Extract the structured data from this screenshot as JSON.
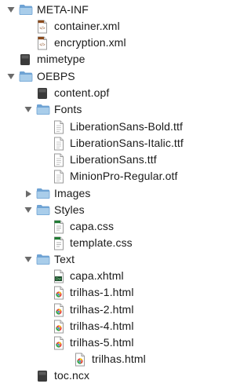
{
  "items": [
    {
      "label": "META-INF",
      "level": 0,
      "kind": "folder",
      "expanded": true
    },
    {
      "label": "container.xml",
      "level": 1,
      "kind": "xml"
    },
    {
      "label": "encryption.xml",
      "level": 1,
      "kind": "xml"
    },
    {
      "label": "mimetype",
      "level": 0,
      "kind": "binary"
    },
    {
      "label": "OEBPS",
      "level": 0,
      "kind": "folder",
      "expanded": true
    },
    {
      "label": "content.opf",
      "level": 1,
      "kind": "binary"
    },
    {
      "label": "Fonts",
      "level": 1,
      "kind": "folder",
      "expanded": true
    },
    {
      "label": "LiberationSans-Bold.ttf",
      "level": 2,
      "kind": "font"
    },
    {
      "label": "LiberationSans-Italic.ttf",
      "level": 2,
      "kind": "font"
    },
    {
      "label": "LiberationSans.ttf",
      "level": 2,
      "kind": "font"
    },
    {
      "label": "MinionPro-Regular.otf",
      "level": 2,
      "kind": "font"
    },
    {
      "label": "Images",
      "level": 1,
      "kind": "folder",
      "expanded": false
    },
    {
      "label": "Styles",
      "level": 1,
      "kind": "folder",
      "expanded": true
    },
    {
      "label": "capa.css",
      "level": 2,
      "kind": "css"
    },
    {
      "label": "template.css",
      "level": 2,
      "kind": "css"
    },
    {
      "label": "Text",
      "level": 1,
      "kind": "folder",
      "expanded": true
    },
    {
      "label": "capa.xhtml",
      "level": 2,
      "kind": "xhtml",
      "badge": "DW"
    },
    {
      "label": "trilhas-1.html",
      "level": 2,
      "kind": "html"
    },
    {
      "label": "trilhas-2.html",
      "level": 2,
      "kind": "html"
    },
    {
      "label": "trilhas-4.html",
      "level": 2,
      "kind": "html"
    },
    {
      "label": "trilhas-5.html",
      "level": 2,
      "kind": "html"
    },
    {
      "label": "trilhas.html",
      "level": 3,
      "kind": "html"
    },
    {
      "label": "toc.ncx",
      "level": 1,
      "kind": "binary"
    }
  ],
  "colors": {
    "folder_light": "#a9cdea",
    "folder_dark": "#6fa3d4",
    "triangle": "#6b6b6b",
    "css_green": "#1f7a33",
    "xml_brown": "#8a4a1c",
    "binary_dark": "#3a3a3a"
  }
}
